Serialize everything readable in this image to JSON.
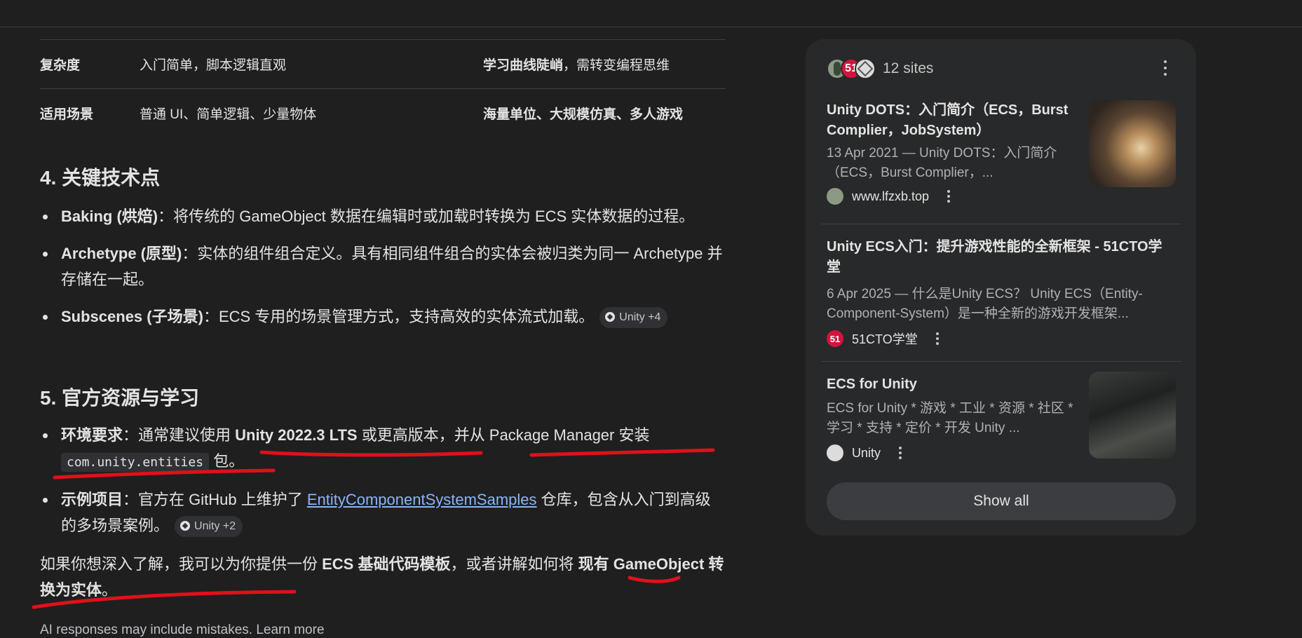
{
  "table": {
    "rows": [
      {
        "head": "复杂度",
        "a": "入门简单，脚本逻辑直观",
        "b_bold": "学习曲线陡峭",
        "b_rest": "，需转变编程思维"
      },
      {
        "head": "适用场景",
        "a": "普通 UI、简单逻辑、少量物体",
        "b_bold": "海量单位、大规模仿真、多人游戏",
        "b_rest": ""
      }
    ]
  },
  "sec4": {
    "title": "4. 关键技术点",
    "items": [
      {
        "bold": "Baking (烘焙)",
        "text": "：将传统的 GameObject 数据在编辑时或加载时转换为 ECS 实体数据的过程。"
      },
      {
        "bold": "Archetype (原型)",
        "text": "：实体的组件组合定义。具有相同组件组合的实体会被归类为同一 Archetype 并存储在一起。"
      },
      {
        "bold": "Subscenes (子场景)",
        "text": "：ECS 专用的场景管理方式，支持高效的实体流式加载。",
        "chip": "Unity +4"
      }
    ]
  },
  "sec5": {
    "title": "5. 官方资源与学习",
    "env": {
      "bold": "环境要求",
      "t1": "：通常建议使用 ",
      "b2": "Unity 2022.3 LTS",
      "t2": " 或更高版本，并从 Package Manager 安装 ",
      "code": "com.unity.entities",
      "t3": " 包。"
    },
    "sample": {
      "bold": "示例项目",
      "t1": "：官方在 GitHub 上维护了 ",
      "link": "EntityComponentSystemSamples",
      "t2": " 仓库，包含从入门到高级的多场景案例。",
      "chip": "Unity +2"
    }
  },
  "closing": {
    "t1": "如果你想深入了解，我可以为你提供一份 ",
    "b1": "ECS 基础代码模板",
    "t2": "，或者讲解如何将 ",
    "b2": "现有 GameObject 转换为实体",
    "t3": "。"
  },
  "disclaimer": "AI responses may include mistakes. Learn more",
  "sources": {
    "count_label": "12 sites",
    "fav2_text": "51",
    "results": [
      {
        "title": "Unity DOTS：入门简介（ECS，Burst Complier，JobSystem）",
        "snippet": "13 Apr 2021 — Unity DOTS：入门简介（ECS，Burst Complier，...",
        "site": "www.lfzxb.top"
      },
      {
        "title": "Unity ECS入门：提升游戏性能的全新框架 - 51CTO学堂",
        "snippet": "6 Apr 2025 — 什么是Unity ECS？ Unity ECS（Entity-Component-System）是一种全新的游戏开发框架...",
        "site": "51CTO学堂",
        "site_icon_text": "51"
      },
      {
        "title": "ECS for Unity",
        "snippet": "ECS for Unity * 游戏 * 工业 * 资源 * 社区 * 学习 * 支持 * 定价 * 开发 Unity ...",
        "site": "Unity"
      }
    ],
    "show_all": "Show all"
  },
  "colors": {
    "background": "#1f1f1f",
    "card": "#28292a",
    "link": "#8ab4f8",
    "annotation": "#e0101a"
  }
}
